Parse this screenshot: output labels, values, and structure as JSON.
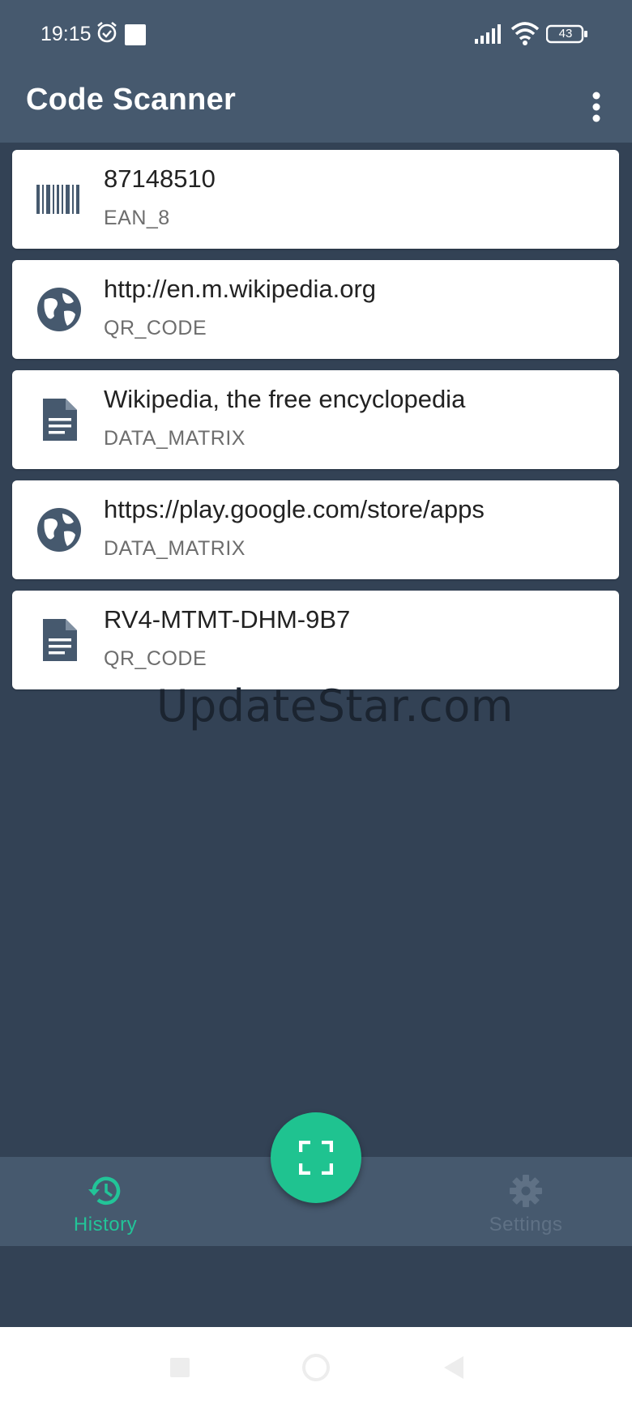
{
  "status_bar": {
    "time": "19:15",
    "battery": "43",
    "icons": [
      "alarm-icon",
      "notification-square-icon",
      "signal-icon",
      "wifi-icon",
      "battery-icon"
    ]
  },
  "app_bar": {
    "title": "Code Scanner",
    "menu_icon": "more-vert-icon"
  },
  "history": [
    {
      "value": "87148510",
      "format": "EAN_8",
      "icon": "barcode-icon"
    },
    {
      "value": "http://en.m.wikipedia.org",
      "format": "QR_CODE",
      "icon": "globe-icon"
    },
    {
      "value": "Wikipedia, the free encyclopedia",
      "format": "DATA_MATRIX",
      "icon": "document-icon"
    },
    {
      "value": "https://play.google.com/store/apps",
      "format": "DATA_MATRIX",
      "icon": "globe-icon"
    },
    {
      "value": "RV4-MTMT-DHM-9B7",
      "format": "QR_CODE",
      "icon": "document-icon"
    }
  ],
  "watermark": "UpdateStar.com",
  "bottom_nav": {
    "history_label": "History",
    "settings_label": "Settings",
    "active": "History"
  },
  "fab": {
    "icon": "scan-frame-icon"
  },
  "colors": {
    "app_bar": "#46596e",
    "background": "#334255",
    "accent": "#1fc390",
    "card": "#ffffff"
  }
}
